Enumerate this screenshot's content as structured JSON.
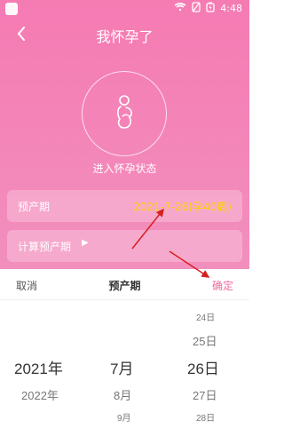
{
  "statusbar": {
    "time": "4:48"
  },
  "header": {
    "title": "我怀孕了"
  },
  "main": {
    "state_text": "进入怀孕状态",
    "due_date_label": "预产期",
    "due_date_value": "2021-7-26(孕40周)",
    "calc_due_date_label": "计算预产期"
  },
  "picker": {
    "cancel_label": "取消",
    "title": "预产期",
    "confirm_label": "确定",
    "years": [
      "2021年",
      "2022年"
    ],
    "months": [
      "7月",
      "8月",
      "9月"
    ],
    "days": [
      "24日",
      "25日",
      "26日",
      "27日",
      "28日"
    ]
  },
  "colors": {
    "accent": "#f06aa0",
    "value_highlight": "#ffd400"
  }
}
